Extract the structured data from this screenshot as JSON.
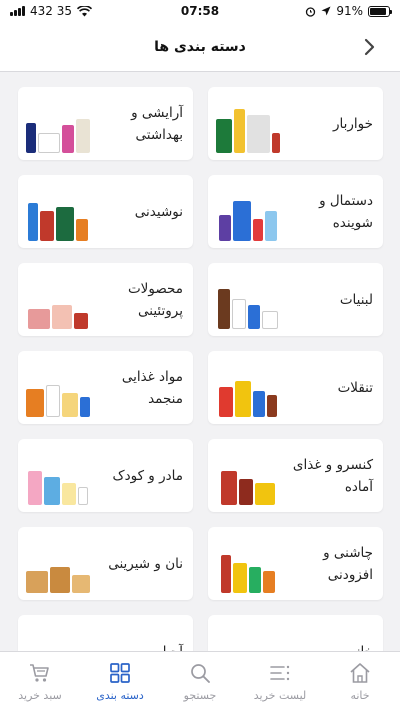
{
  "status_bar": {
    "carrier_signal": "432 35",
    "time": "07:58",
    "battery_percent": "91%",
    "battery_level": 0.91
  },
  "header": {
    "title": "دسته بندی ها",
    "back_icon": "chevron-right-icon"
  },
  "categories": [
    {
      "label": "خواربار",
      "image": "groceries"
    },
    {
      "label": "آرایشی و\nبهداشتی",
      "image": "cosmetics"
    },
    {
      "label": "دستمال و\nشوینده",
      "image": "detergents"
    },
    {
      "label": "نوشیدنی",
      "image": "drinks"
    },
    {
      "label": "لبنیات",
      "image": "dairy"
    },
    {
      "label": "محصولات\nپروتئینی",
      "image": "protein"
    },
    {
      "label": "تنقلات",
      "image": "snacks"
    },
    {
      "label": "مواد غذایی\nمنجمد",
      "image": "frozen"
    },
    {
      "label": "کنسرو و غذای\nآماده",
      "image": "canned"
    },
    {
      "label": "مادر و کودک",
      "image": "baby"
    },
    {
      "label": "چاشنی و\nافزودنی",
      "image": "condiments"
    },
    {
      "label": "نان و شیرینی",
      "image": "bakery"
    },
    {
      "label": "خانه و",
      "image": "home"
    },
    {
      "label": "آجیل و",
      "image": "nuts"
    }
  ],
  "tab_bar": {
    "tabs": [
      {
        "label": "سبد خرید",
        "icon": "cart-icon"
      },
      {
        "label": "دسته بندی",
        "icon": "grid-icon"
      },
      {
        "label": "جستجو",
        "icon": "search-icon"
      },
      {
        "label": "لیست خرید",
        "icon": "list-icon"
      },
      {
        "label": "خانه",
        "icon": "home-icon"
      }
    ],
    "active_tab": "دسته بندی",
    "active_color": "#2a63c8",
    "inactive_color": "#9b9ba2"
  }
}
